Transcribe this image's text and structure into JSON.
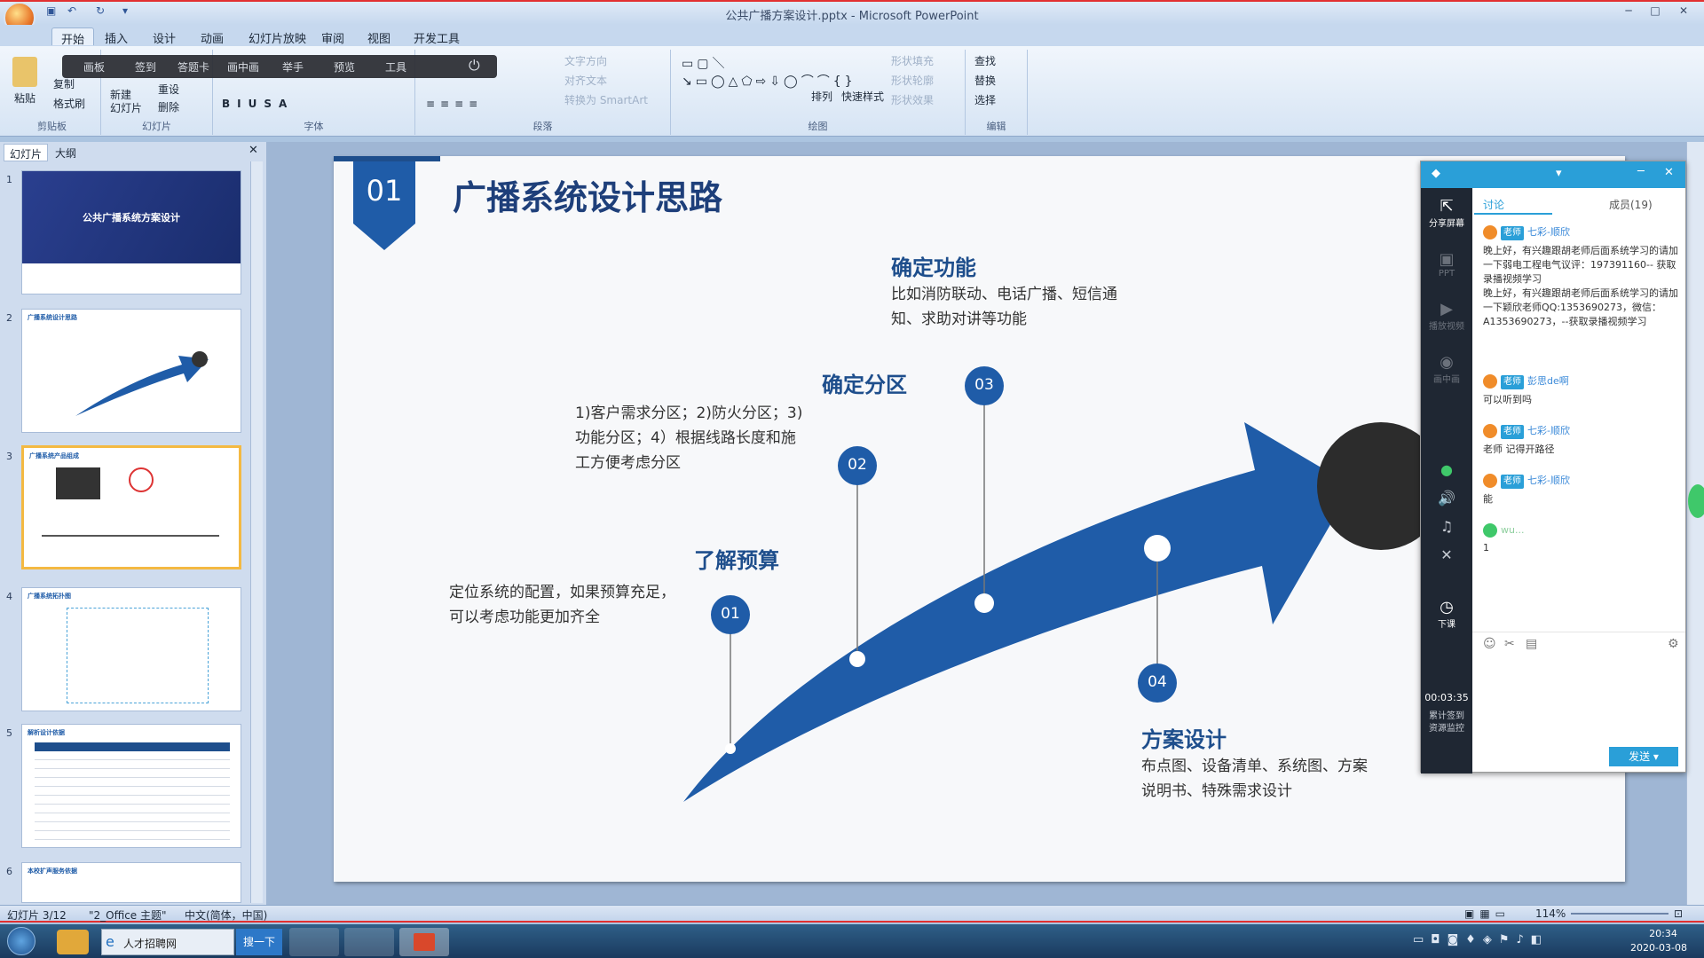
{
  "window": {
    "title": "公共广播方案设计.pptx - Microsoft PowerPoint"
  },
  "ribbon": {
    "tabs": [
      "开始",
      "插入",
      "设计",
      "动画",
      "幻灯片放映",
      "审阅",
      "视图",
      "开发工具"
    ],
    "active_tab": "开始",
    "groups": {
      "clipboard": "剪贴板",
      "slides": "幻灯片",
      "font": "字体",
      "paragraph": "段落",
      "drawing": "绘图",
      "editing": "编辑"
    },
    "buttons": {
      "paste": "粘贴",
      "copy": "复制",
      "format_painter": "格式刷",
      "new_slide": "新建\n幻灯片",
      "reset": "重设",
      "delete": "删除",
      "arrange": "排列",
      "quick_styles": "快速样式",
      "shape_fill": "形状填充",
      "shape_outline": "形状轮廓",
      "shape_effects": "形状效果",
      "find": "查找",
      "replace": "替换",
      "select": "选择",
      "text_direction": "文字方向",
      "align_text": "对齐文本",
      "smartart": "转换为 SmartArt"
    }
  },
  "floatbar": {
    "items": [
      "画板",
      "签到",
      "答题卡",
      "画中画",
      "举手",
      "预览",
      "工具"
    ]
  },
  "left_pane": {
    "tabs": [
      "幻灯片",
      "大纲"
    ],
    "thumbs": [
      {
        "num": "1",
        "title": "公共广播系统方案设计"
      },
      {
        "num": "2",
        "title": "广播系统设计思路"
      },
      {
        "num": "3",
        "title": "广播系统产品组成"
      },
      {
        "num": "4",
        "title": "广播系统拓扑图"
      },
      {
        "num": "5",
        "title": "解析设计依据"
      },
      {
        "num": "6",
        "title": "本校扩声服务依据"
      }
    ]
  },
  "slide": {
    "number_badge": "01",
    "title": "广播系统设计思路",
    "steps": [
      {
        "num": "01",
        "heading": "了解预算",
        "body": "定位系统的配置，如果预算充足，\n可以考虑功能更加齐全"
      },
      {
        "num": "02",
        "heading": "确定分区",
        "body": "1)客户需求分区；2)防火分区；3)\n功能分区；4）根据线路长度和施\n工方便考虑分区"
      },
      {
        "num": "03",
        "heading": "确定功能",
        "body": "比如消防联动、电话广播、短信通\n知、求助对讲等功能"
      },
      {
        "num": "04",
        "heading": "方案设计",
        "body": "布点图、设备清单、系统图、方案\n说明书、特殊需求设计"
      }
    ]
  },
  "panel": {
    "tabs": [
      "讨论",
      "成员(19)"
    ],
    "side": [
      "分享屏幕",
      "PPT",
      "播放视频",
      "画中画",
      "下课"
    ],
    "timer": "00:03:35",
    "side_extra": [
      "累计签到",
      "资源监控"
    ],
    "messages": [
      {
        "badge": "老师",
        "name": "七彩-顺欣",
        "text": "晚上好，有兴趣跟胡老师后面系统学习的请加一下弱电工程电气议评：197391160-- 获取录播视频学习\n晚上好，有兴趣跟胡老师后面系统学习的请加一下颖欣老师QQ:1353690273，微信：A1353690273，--获取录播视频学习"
      },
      {
        "badge": "老师",
        "name": "彭思de啊",
        "text": "可以听到吗"
      },
      {
        "badge": "老师",
        "name": "七彩-顺欣",
        "text": "老师 记得开路径"
      },
      {
        "badge": "老师",
        "name": "七彩-顺欣",
        "text": "能"
      },
      {
        "badge": "",
        "name": "wu...",
        "text": "1"
      }
    ],
    "send": "发送"
  },
  "statusbar": {
    "slide": "幻灯片 3/12",
    "theme": "\"2_Office 主题\"",
    "lang": "中文(简体，中国)",
    "zoom": "114%"
  },
  "taskbar": {
    "browser": "人才招聘网",
    "search": "搜一下",
    "time": "20:34",
    "date": "2020-03-08"
  },
  "colors": {
    "accent": "#1f5ca8",
    "dark_blue": "#1e4e8c"
  }
}
